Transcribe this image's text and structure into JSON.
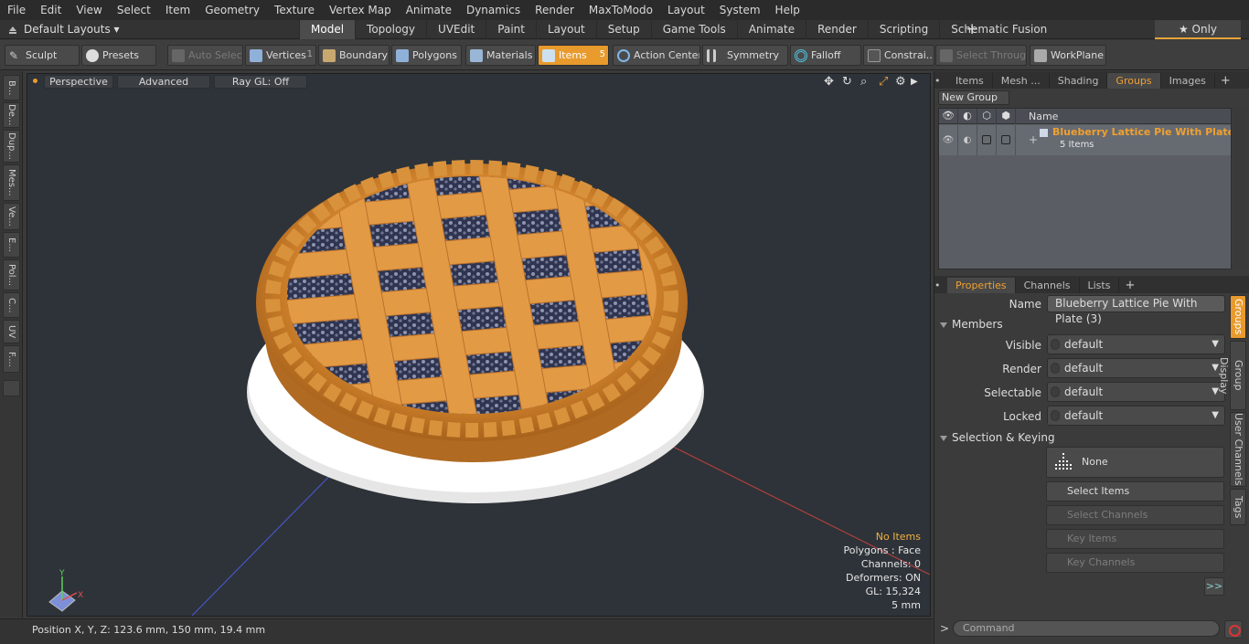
{
  "menubar": {
    "items": [
      "File",
      "Edit",
      "View",
      "Select",
      "Item",
      "Geometry",
      "Texture",
      "Vertex Map",
      "Animate",
      "Dynamics",
      "Render",
      "MaxToModo",
      "Layout",
      "System",
      "Help"
    ]
  },
  "layoutbar": {
    "layout_label": "Default Layouts ▾",
    "tabs": [
      "Model",
      "Topology",
      "UVEdit",
      "Paint",
      "Layout",
      "Setup",
      "Game Tools",
      "Animate",
      "Render",
      "Scripting",
      "Schematic Fusion"
    ],
    "active_tab": "Model",
    "plus": "+",
    "only_label": "★ Only"
  },
  "toolbar": {
    "sculpt": "Sculpt",
    "presets": "Presets",
    "auto_select": "Auto Select",
    "vertices": "Vertices",
    "vertices_count": "1",
    "boundary": "Boundary",
    "polygons": "Polygons",
    "materials": "Materials",
    "items": "Items",
    "items_count": "5",
    "action_center": "Action Center",
    "symmetry": "Symmetry",
    "falloff": "Falloff",
    "constraints": "Constrai...",
    "select_through": "Select Through",
    "workplane": "WorkPlane"
  },
  "left_tabs": [
    "B...",
    "De...",
    "Dup...",
    "Mes...",
    "Ve...",
    "E...",
    "Pol...",
    "C...",
    "UV",
    "F...."
  ],
  "viewport": {
    "perspective": "Perspective",
    "advanced": "Advanced",
    "raygl": "Ray GL: Off",
    "info": {
      "selection": "No Items",
      "polygons": "Polygons : Face",
      "channels": "Channels: 0",
      "deformers": "Deformers: ON",
      "gl": "GL: 15,324",
      "unit": "5 mm"
    },
    "axis_y": "Y",
    "axis_x": "X"
  },
  "statusbar": {
    "position": "Position X, Y, Z:   123.6 mm, 150 mm, 19.4 mm"
  },
  "panel_top": {
    "tabs": [
      "Items",
      "Mesh ...",
      "Shading",
      "Groups",
      "Images"
    ],
    "active_tab": "Groups",
    "new_group": "New Group",
    "name_header": "Name",
    "group": {
      "name": "Blueberry Lattice Pie With Plate ...",
      "count": "5 Items"
    }
  },
  "properties": {
    "tabs": [
      "Properties",
      "Channels",
      "Lists"
    ],
    "active_tab": "Properties",
    "name_label": "Name",
    "name_value": "Blueberry Lattice Pie With Plate (3)",
    "members_label": "Members",
    "visible_label": "Visible",
    "visible_value": "default",
    "render_label": "Render",
    "render_value": "default",
    "selectable_label": "Selectable",
    "selectable_value": "default",
    "locked_label": "Locked",
    "locked_value": "default",
    "selkey_label": "Selection & Keying",
    "none_label": "None",
    "select_items": "Select Items",
    "select_channels": "Select Channels",
    "key_items": "Key Items",
    "key_channels": "Key Channels",
    "more": ">>",
    "side_tabs": [
      "Groups",
      "Group Display",
      "User Channels",
      "Tags"
    ],
    "command_placeholder": "Command",
    "command_arrow": ">"
  },
  "colors": {
    "accent": "#e89a2c",
    "viewport_bg": "#2e3339"
  }
}
